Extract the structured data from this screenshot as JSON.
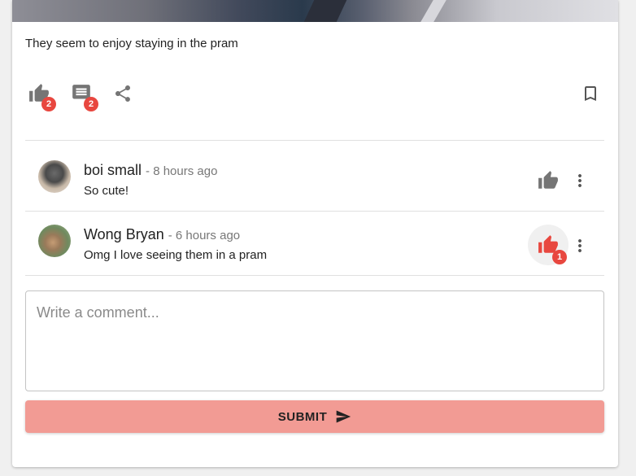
{
  "post": {
    "caption": "They seem to enjoy staying in the pram",
    "likes_count": "2",
    "comments_count": "2"
  },
  "comments": [
    {
      "author": "boi small",
      "time": "- 8 hours ago",
      "text": "So cute!",
      "likes": ""
    },
    {
      "author": "Wong Bryan",
      "time": "- 6 hours ago",
      "text": "Omg I love seeing them in a pram",
      "likes": "1"
    }
  ],
  "composer": {
    "placeholder": "Write a comment...",
    "submit_label": "SUBMIT"
  },
  "colors": {
    "accent": "#e8473f",
    "submit_bg": "#f29b94",
    "icon_grey": "#757575"
  },
  "icons": [
    "thumb-up-icon",
    "comment-icon",
    "share-icon",
    "bookmark-icon",
    "more-vert-icon",
    "send-icon"
  ]
}
